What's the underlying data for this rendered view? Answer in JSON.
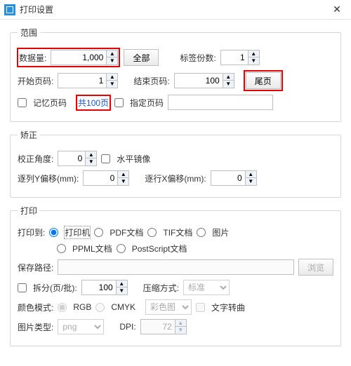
{
  "window": {
    "title": "打印设置"
  },
  "range": {
    "legend": "范围",
    "data_count_label": "数据量:",
    "data_count_value": "1,000",
    "all_button": "全部",
    "copies_label": "标签份数:",
    "copies_value": "1",
    "start_page_label": "开始页码:",
    "start_page_value": "1",
    "end_page_label": "结束页码:",
    "end_page_value": "100",
    "last_page_button": "尾页",
    "remember_page_label": "记忆页码",
    "total_pages_label": "共100页",
    "specify_page_label": "指定页码",
    "specify_page_value": ""
  },
  "correct": {
    "legend": "矫正",
    "angle_label": "校正角度:",
    "angle_value": "0",
    "mirror_label": "水平镜像",
    "col_y_label": "逐列Y偏移(mm):",
    "col_y_value": "0",
    "row_x_label": "逐行X偏移(mm):",
    "row_x_value": "0"
  },
  "print": {
    "legend": "打印",
    "print_to_label": "打印到:",
    "opt_printer": "打印机",
    "opt_pdf": "PDF文档",
    "opt_tif": "TIF文档",
    "opt_image": "图片",
    "opt_ppml": "PPML文档",
    "opt_ps": "PostScript文档",
    "save_path_label": "保存路径:",
    "save_path_value": "",
    "browse_button": "浏览",
    "split_label": "拆分(页/批):",
    "split_value": "100",
    "compress_label": "压缩方式:",
    "compress_value": "标准",
    "color_mode_label": "颜色模式:",
    "color_rgb": "RGB",
    "color_cmyk": "CMYK",
    "color_profile_value": "彩色图",
    "text_curve_label": "文字转曲",
    "image_type_label": "图片类型:",
    "image_type_value": "png",
    "dpi_label": "DPI:",
    "dpi_value": "72"
  }
}
